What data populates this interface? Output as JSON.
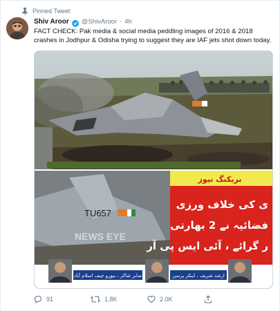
{
  "pinned": {
    "label": "Pinned Tweet"
  },
  "author": {
    "name": "Shiv Aroor",
    "handle": "@ShivAroor",
    "separator": "·",
    "time": "4h"
  },
  "tweet": {
    "text": "FACT CHECK: Pak media & social media peddling images of 2016 & 2018 crashes in Jodhpur & Odisha trying to suggest they are IAF jets shot down today."
  },
  "media": {
    "photo2": {
      "tail_code": "TU657",
      "watermark": "NEWS EYE",
      "banner_title": "بریکنگ نیوز",
      "urdu_lines": [
        "ی کی خلاف ورزی",
        "فضائیہ نے 2 بھارتی",
        "ر گرائے ، آئی ایس پی آر"
      ],
      "lower_caption_left": "صابر شاکر ، بیورو چیف اسلام آباد",
      "lower_caption_right": "ارشد شریف ، اینکر پرسن"
    }
  },
  "actions": {
    "reply_count": "91",
    "retweet_count": "1.8K",
    "like_count": "2.0K"
  },
  "colors": {
    "accent": "#1da1f2",
    "secondary_text": "#657786",
    "banner_red": "#d9231d"
  }
}
